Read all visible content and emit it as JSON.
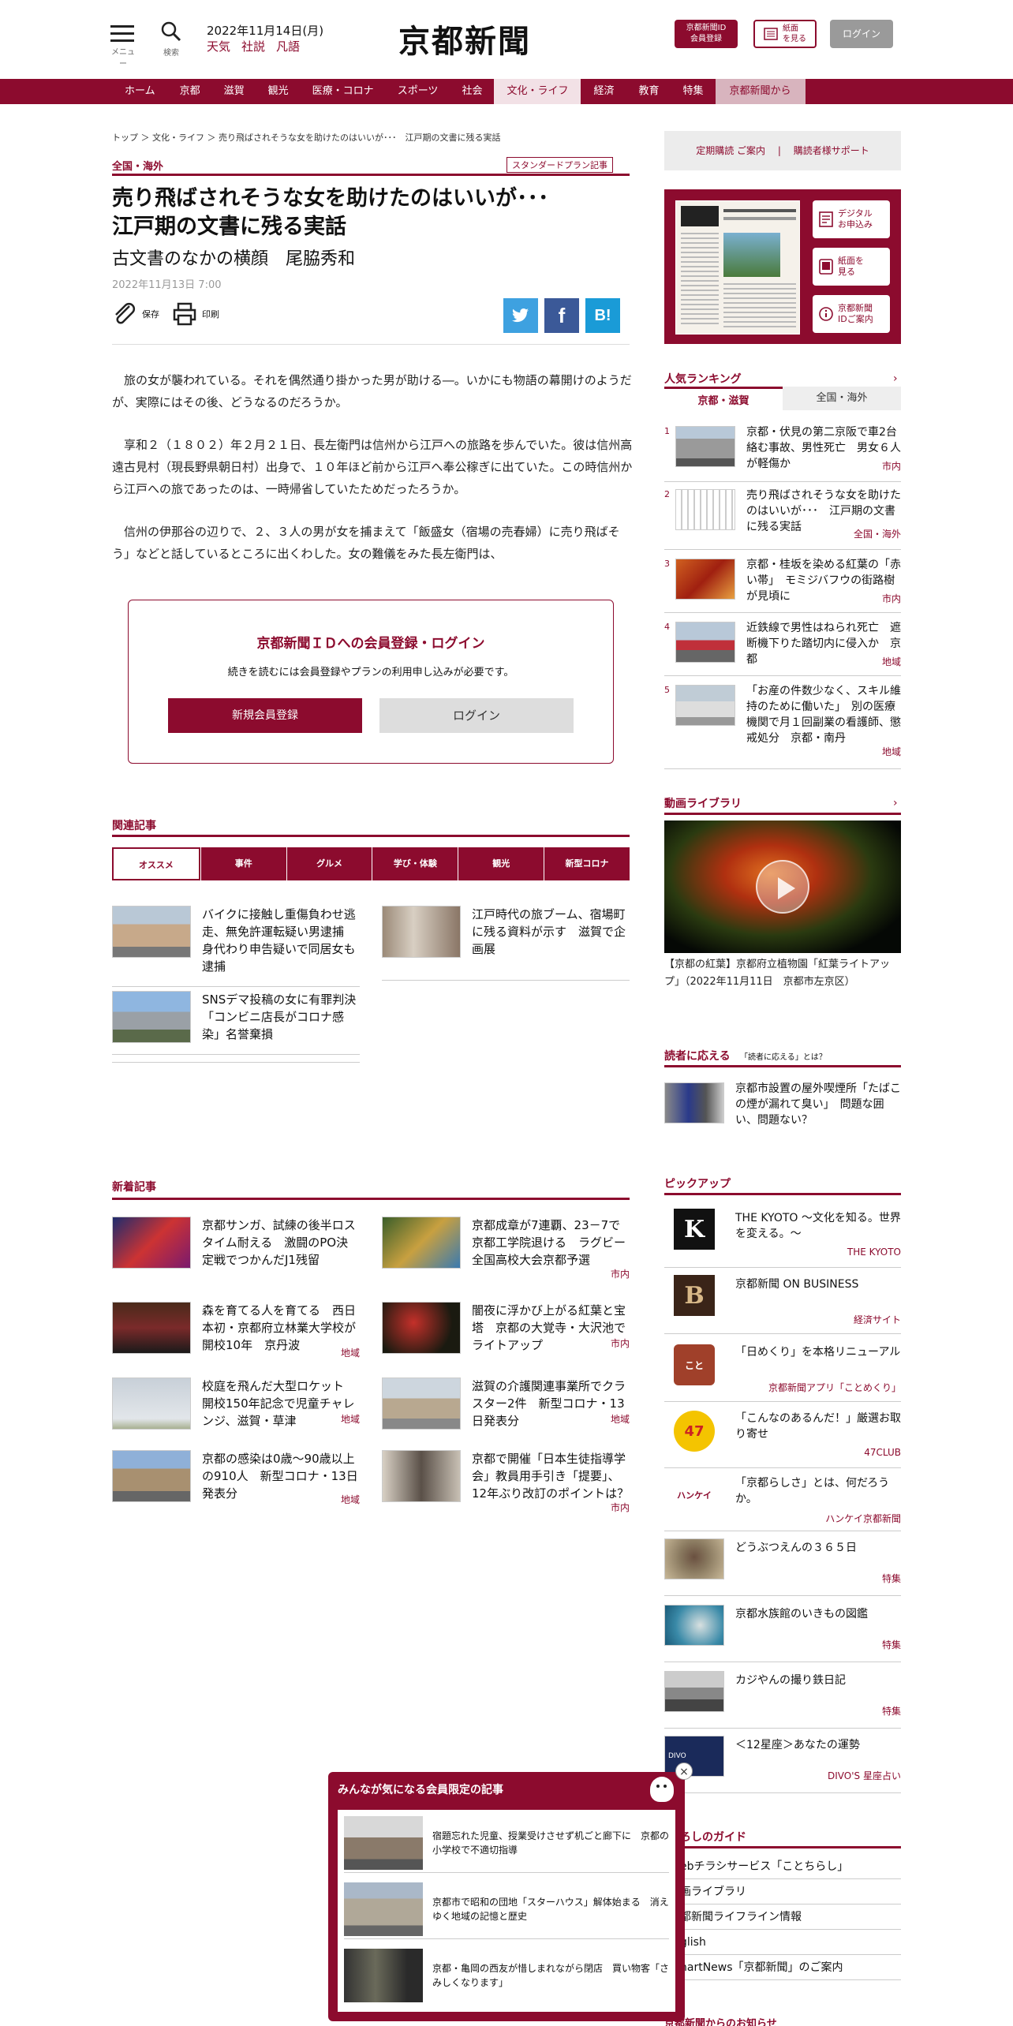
{
  "header": {
    "menu_label": "メニュー",
    "search_label": "検索",
    "date": "2022年11月14日(月)",
    "quick_links": [
      "天気",
      "社説",
      "凡語"
    ],
    "logo": "京都新聞",
    "register_label_1": "京都新聞ID",
    "register_label_2": "会員登録",
    "paper_label_1": "紙面",
    "paper_label_2": "を見る",
    "login_label": "ログイン"
  },
  "nav": {
    "items": [
      "ホーム",
      "京都",
      "滋賀",
      "観光",
      "医療・コロナ",
      "スポーツ",
      "社会",
      "文化・ライフ",
      "経済",
      "教育",
      "特集",
      "京都新聞から"
    ]
  },
  "article": {
    "breadcrumb": "トップ ＞ 文化・ライフ ＞ 売り飛ばされそうな女を助けたのはいいが･･･　江戸期の文書に残る実話",
    "category": "全国・海外",
    "plan_badge": "スタンダードプラン記事",
    "title_1": "売り飛ばされそうな女を助けたのはいいが･･･",
    "title_2": "江戸期の文書に残る実話",
    "subtitle": "古文書のなかの横顔　尾脇秀和",
    "date": "2022年11月13日 7:00",
    "save_label": "保存",
    "print_label": "印刷",
    "paragraphs": [
      "旅の女が襲われている。それを偶然通り掛かった男が助ける―。いかにも物語の幕開けのようだが、実際にはその後、どうなるのだろうか。",
      "享和２（１８０２）年２月２１日、長左衛門は信州から江戸への旅路を歩んでいた。彼は信州高遠古見村（現長野県朝日村）出身で、１０年ほど前から江戸へ奉公稼ぎに出ていた。この時信州から江戸への旅であったのは、一時帰省していたためだったろうか。",
      "信州の伊那谷の辺りで、２、３人の男が女を捕まえて「飯盛女（宿場の売春婦）に売り飛ばそう」などと話しているところに出くわした。女の難儀をみた長左衛門は、"
    ]
  },
  "login_box": {
    "title": "京都新聞ＩＤへの会員登録・ログイン",
    "text": "続きを読むには会員登録やプランの利用申し込みが必要です。",
    "register_button": "新規会員登録",
    "login_button": "ログイン"
  },
  "related": {
    "heading": "関連記事",
    "tabs": [
      "オススメ",
      "事件",
      "グルメ",
      "学び・体験",
      "観光",
      "新型コロナ"
    ],
    "items": [
      {
        "title": "バイクに接触し重傷負わせ逃走、無免許運転疑い男逮捕　身代わり申告疑いで同居女も逮捕"
      },
      {
        "title": "江戸時代の旅ブーム、宿場町に残る資料が示す　滋賀で企画展"
      },
      {
        "title": "SNSデマ投稿の女に有罪判決　「コンビニ店長がコロナ感染」名誉棄損"
      }
    ]
  },
  "latest": {
    "heading": "新着記事",
    "items": [
      {
        "title": "京都サンガ、試練の後半ロスタイム耐える　激闘のPO決定戦でつかんだJ1残留",
        "tag": ""
      },
      {
        "title": "京都成章が7連覇、23－7で京都工学院退ける　ラグビー全国高校大会京都予選",
        "tag": "市内"
      },
      {
        "title": "森を育てる人を育てる　西日本初・京都府立林業大学校が開校10年　京丹波",
        "tag": "地域"
      },
      {
        "title": "闇夜に浮かび上がる紅葉と宝塔　京都の大覚寺・大沢池でライトアップ",
        "tag": "市内"
      },
      {
        "title": "校庭を飛んだ大型ロケット　開校150年記念で児童チャレンジ、滋賀・草津",
        "tag": "地域"
      },
      {
        "title": "滋賀の介護関連事業所でクラスター2件　新型コロナ・13日発表分",
        "tag": "地域"
      },
      {
        "title": "京都の感染は0歳～90歳以上の910人　新型コロナ・13日発表分",
        "tag": "地域"
      },
      {
        "title": "京都で開催「日本生徒指導学会」教員用手引き「提要」、12年ぶり改訂のポイントは？",
        "tag": "市内"
      }
    ]
  },
  "sidebar": {
    "subscribe_link": "定期購読 ご案内",
    "support_link": "購読者様サポート",
    "paper_buttons": [
      {
        "l1": "デジタル",
        "l2": "お申込み"
      },
      {
        "l1": "紙面を",
        "l2": "見る"
      },
      {
        "l1": "京都新聞",
        "l2": "IDご案内"
      }
    ],
    "ranking_heading": "人気ランキング",
    "ranking_tabs": [
      "京都・滋賀",
      "全国・海外"
    ],
    "ranking": [
      {
        "num": "1",
        "title": "京都・伏見の第二京阪で車2台絡む事故、男性死亡　男女６人が軽傷か",
        "tag": "市内"
      },
      {
        "num": "2",
        "title": "売り飛ばされそうな女を助けたのはいいが･･･　江戸期の文書に残る実話",
        "tag": "全国・海外"
      },
      {
        "num": "3",
        "title": "京都・桂坂を染める紅葉の「赤い帯」　モミジバフウの街路樹が見頃に",
        "tag": "市内"
      },
      {
        "num": "4",
        "title": "近鉄線で男性はねられ死亡　遮断機下りた踏切内に侵入か　京都",
        "tag": "地域"
      },
      {
        "num": "5",
        "title": "「お産の件数少なく、スキル維持のために働いた」　別の医療機関で月１回副業の看護師、懲戒処分　京都・南丹",
        "tag": "地域"
      }
    ],
    "video_heading": "動画ライブラリ",
    "video_caption": "【京都の紅葉】京都府立植物園「紅葉ライトアップ」（2022年11月11日　京都市左京区）",
    "reader_heading": "読者に応える",
    "reader_sub": "「読者に応える」とは？",
    "reader_item": "京都市設置の屋外喫煙所「たばこの煙が漏れて臭い」　問題な囲い、問題ない？",
    "pickup_heading": "ピックアップ",
    "pickup": [
      {
        "title": "THE KYOTO ～文化を知る。世界を変える。～",
        "tag": "THE KYOTO",
        "logo": "K"
      },
      {
        "title": "京都新聞 ON BUSINESS",
        "tag": "経済サイト",
        "logo": "B"
      },
      {
        "title": "「日めくり」を本格リニューアル",
        "tag": "京都新聞アプリ「ことめくり」",
        "logo": "こと"
      },
      {
        "title": "「こんなのあるんだ！」厳選お取り寄せ",
        "tag": "47CLUB",
        "logo": "47"
      },
      {
        "title": "「京都らしさ」とは、何だろうか。",
        "tag": "ハンケイ京都新聞",
        "logo": "ハンケイ"
      },
      {
        "title": "どうぶつえんの３６５日",
        "tag": "特集",
        "logo": ""
      },
      {
        "title": "京都水族館のいきもの図鑑",
        "tag": "特集",
        "logo": ""
      },
      {
        "title": "カジやんの撮り鉄日記",
        "tag": "特集",
        "logo": ""
      },
      {
        "title": "＜12星座＞あなたの運勢",
        "tag": "DIVO'S 星座占い",
        "logo": "DIVO"
      }
    ],
    "guide_heading": "ろしのガイド",
    "guide_links": [
      "ebチラシサービス「ことちらし」",
      "画ライブラリ",
      "都新聞ライフライン情報",
      "glish",
      "nartNews「京都新聞」のご案内"
    ],
    "notice_heading": "京都新聞からのお知らせ"
  },
  "popup": {
    "heading": "みんなが気になる会員限定の記事",
    "items": [
      "宿題忘れた児童、授業受けさせず机ごと廊下に　京都の小学校で不適切指導",
      "京都市で昭和の団地「スターハウス」解体始まる　消えゆく地域の記憶と歴史",
      "京都・亀岡の西友が惜しまれながら閉店　買い物客「さみしくなります」"
    ]
  },
  "colors": {
    "accent": "#8c0b2e"
  }
}
